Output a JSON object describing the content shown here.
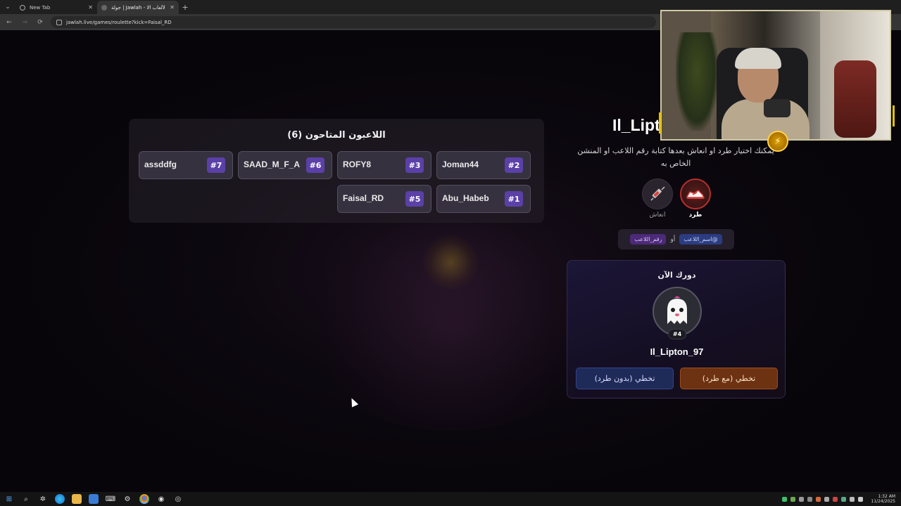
{
  "browser": {
    "tabs": [
      {
        "title": "New Tab",
        "active": false
      },
      {
        "title": "جولة | Jawlah - منصة الألعاب الا",
        "active": true
      }
    ],
    "url": "jawlah.live/games/roulette?kick=Faisal_RD"
  },
  "players_panel": {
    "title": "اللاعبون المتاحون (6)",
    "players": [
      {
        "name": "assddfg",
        "number": "#7"
      },
      {
        "name": "SAAD_M_F_A",
        "number": "#6"
      },
      {
        "name": "ROFY8",
        "number": "#3"
      },
      {
        "name": "Joman44",
        "number": "#2"
      },
      {
        "name": "Faisal_RD",
        "number": "#5"
      },
      {
        "name": "Abu_Habeb",
        "number": "#1"
      }
    ]
  },
  "current_player": {
    "header_name": "Il_Lipt",
    "instructions": "يمكنك اختيار طرد او انعاش بعدها كتابة رقم اللاعب او المنشن الخاص به",
    "actions": {
      "kick_label": "طرد",
      "revive_label": "انعاش"
    },
    "syntax": {
      "mention_chip": "@اسم_اللاعب",
      "or_label": "أو",
      "number_chip": "رقم_اللاعب"
    }
  },
  "turn_card": {
    "title": "دورك الآن",
    "player_number": "#4",
    "player_name": "Il_Lipton_97",
    "skip_no_kick": "تخطي (بدون طرد)",
    "skip_with_kick": "تخطي (مع طرد)"
  },
  "taskbar": {
    "time": "1:32 AM",
    "date": "11/24/2025"
  },
  "colors": {
    "number_badge": "#5b40a8",
    "kick_accent": "#b8302c",
    "skip_no_kick_bg": "#1e2a58",
    "skip_with_kick_bg": "#6c3212",
    "webcam_badge": "#e0a100"
  }
}
